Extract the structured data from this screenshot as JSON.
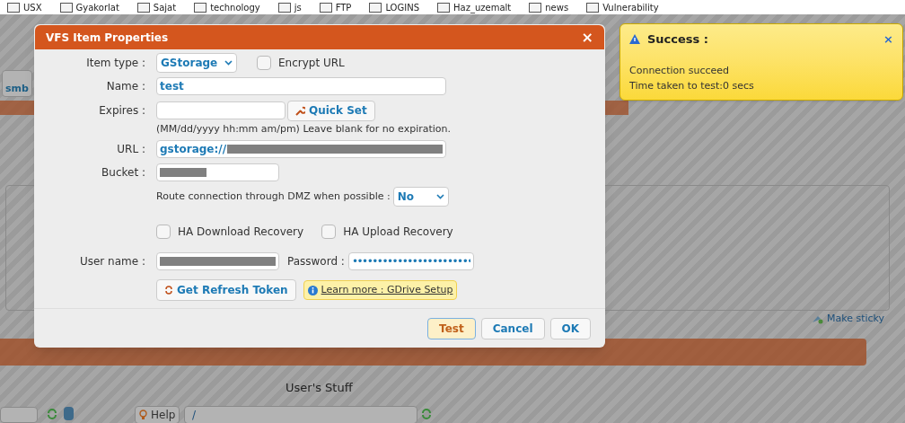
{
  "bookmarks": [
    "USX",
    "Gyakorlat",
    "Sajat",
    "technology",
    "js",
    "FTP",
    "LOGINS",
    "Haz_uzemalt",
    "news",
    "Vulnerability"
  ],
  "background": {
    "tab_label": "smb",
    "make_sticky": "Make sticky",
    "section_title": "User's Stuff",
    "help_button": "Help",
    "path_select": "/"
  },
  "dialog": {
    "title": "VFS Item Properties",
    "close": "×",
    "item_type": {
      "label": "Item type :",
      "value": "GStorage"
    },
    "encrypt_url": {
      "label": "Encrypt URL",
      "checked": false
    },
    "name": {
      "label": "Name :",
      "value": "test"
    },
    "expires": {
      "label": "Expires :"
    },
    "quick_set": "Quick Set",
    "expires_hint": "(MM/dd/yyyy hh:mm am/pm) Leave blank for no expiration.",
    "url": {
      "label": "URL :",
      "value": "gstorage://"
    },
    "bucket": {
      "label": "Bucket :"
    },
    "dmz": {
      "label": "Route connection through DMZ when possible :",
      "value": "No"
    },
    "ha_download": {
      "label": "HA Download Recovery",
      "checked": false
    },
    "ha_upload": {
      "label": "HA Upload Recovery",
      "checked": false
    },
    "user_name": {
      "label": "User name :"
    },
    "password": {
      "label": "Password :",
      "value": "••••••••••••••••••••••••"
    },
    "refresh_token": "Get Refresh Token",
    "learn_more": "Learn more : GDrive Setup",
    "buttons": [
      {
        "label": "Test",
        "selected": true
      },
      {
        "label": "Cancel",
        "selected": false
      },
      {
        "label": "OK",
        "selected": false
      }
    ]
  },
  "toast": {
    "title": "Success :",
    "close": "×",
    "lines": [
      "Connection succeed",
      "Time taken to test:0 secs"
    ]
  }
}
